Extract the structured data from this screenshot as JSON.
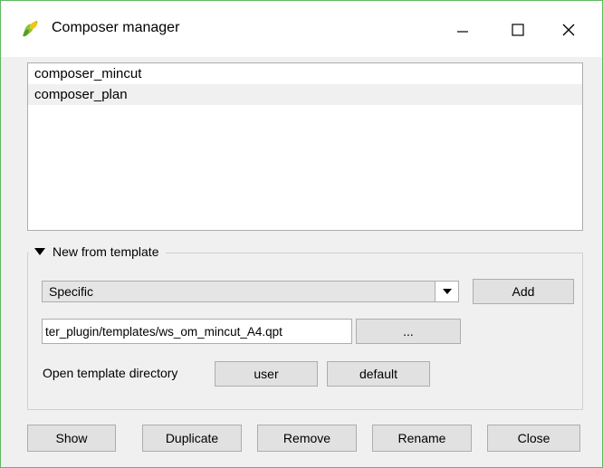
{
  "window": {
    "title": "Composer manager",
    "app_icon": "qgis-logo-icon",
    "controls": [
      "minimize-icon",
      "maximize-icon",
      "close-icon"
    ]
  },
  "composer_list": {
    "items": [
      {
        "label": "composer_mincut"
      },
      {
        "label": "composer_plan"
      }
    ]
  },
  "template_group": {
    "title": "New from template",
    "combo_value": "Specific",
    "add_label": "Add",
    "path_value": "ter_plugin/templates/ws_om_mincut_A4.qpt",
    "browse_label": "...",
    "open_dir_label": "Open template directory",
    "user_label": "user",
    "default_label": "default"
  },
  "footer": {
    "show_label": "Show",
    "duplicate_label": "Duplicate",
    "remove_label": "Remove",
    "rename_label": "Rename",
    "close_label": "Close"
  }
}
